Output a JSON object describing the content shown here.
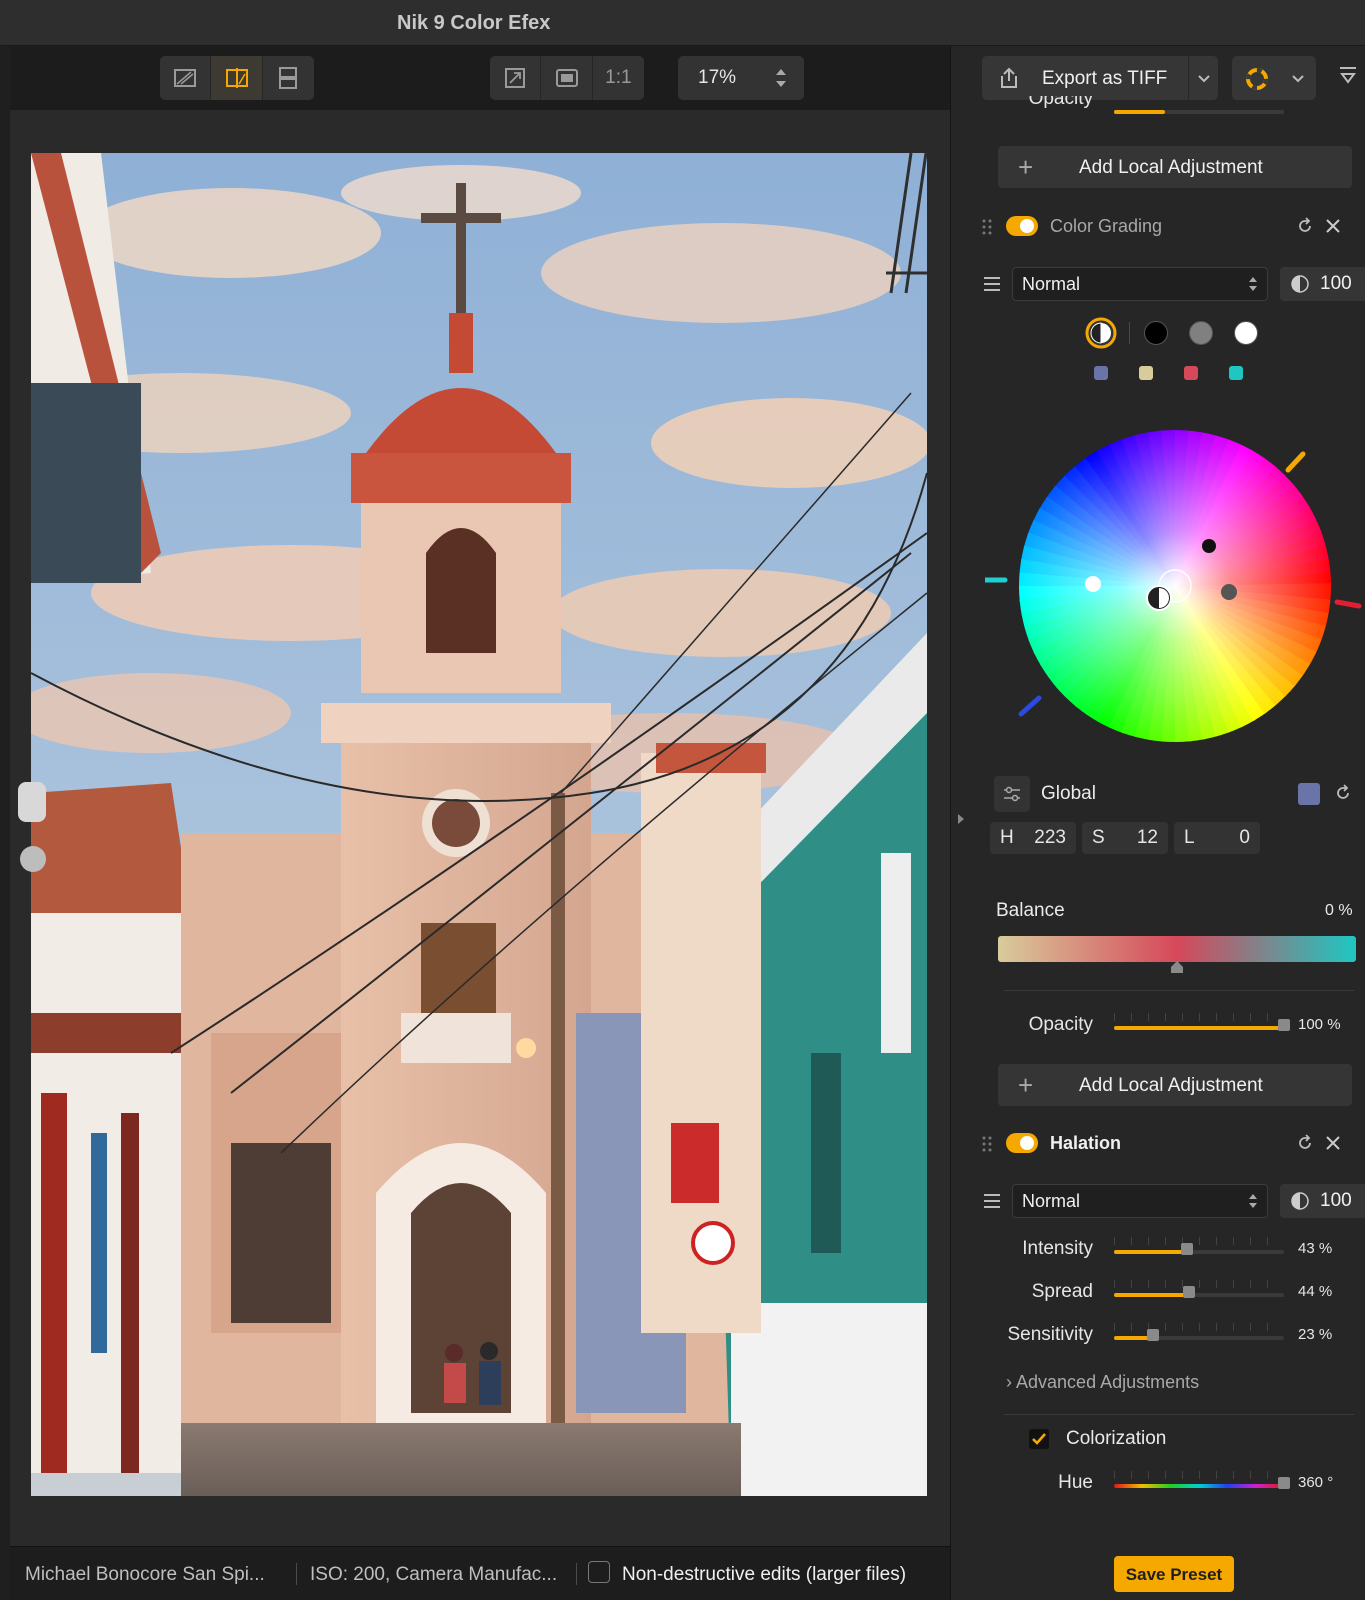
{
  "window": {
    "title": "Nik 9 Color Efex"
  },
  "toolbar": {
    "zoom": "17%",
    "actual_size": "1:1"
  },
  "export": {
    "label": "Export as TIFF"
  },
  "panel": {
    "top_partial_label": "Opacity",
    "add_local_label": "Add Local Adjustment",
    "color_grading": {
      "title": "Color Grading",
      "blend_mode": "Normal",
      "blend_opacity": "100",
      "region_swatches": [
        "#000000",
        "#808080",
        "#ffffff"
      ],
      "color_swatches": [
        "#6a74a8",
        "#d8cc9c",
        "#d6485a",
        "#1ec7c2"
      ],
      "mode_label": "Global",
      "h_label": "H",
      "h_value": "223",
      "s_label": "S",
      "s_value": "12",
      "l_label": "L",
      "l_value": "0",
      "balance_label": "Balance",
      "balance_value": "0 %",
      "opacity_label": "Opacity",
      "opacity_value": "100 %",
      "opacity_fraction": 1.0
    },
    "halation": {
      "title": "Halation",
      "blend_mode": "Normal",
      "blend_opacity": "100",
      "sliders": [
        {
          "label": "Intensity",
          "value": "43 %",
          "fraction": 0.43
        },
        {
          "label": "Spread",
          "value": "44 %",
          "fraction": 0.44
        },
        {
          "label": "Sensitivity",
          "value": "23 %",
          "fraction": 0.23
        }
      ],
      "advanced_label": "Advanced Adjustments",
      "colorization_label": "Colorization",
      "colorization_checked": true,
      "hue_label": "Hue",
      "hue_value": "360 °"
    },
    "save_preset": "Save Preset"
  },
  "status": {
    "file": "Michael Bonocore San Spi...",
    "meta": "ISO: 200, Camera Manufac...",
    "nondestructive": "Non-destructive edits (larger files)"
  },
  "colors": {
    "accent": "#f5a800",
    "panel_bg": "#262626"
  }
}
